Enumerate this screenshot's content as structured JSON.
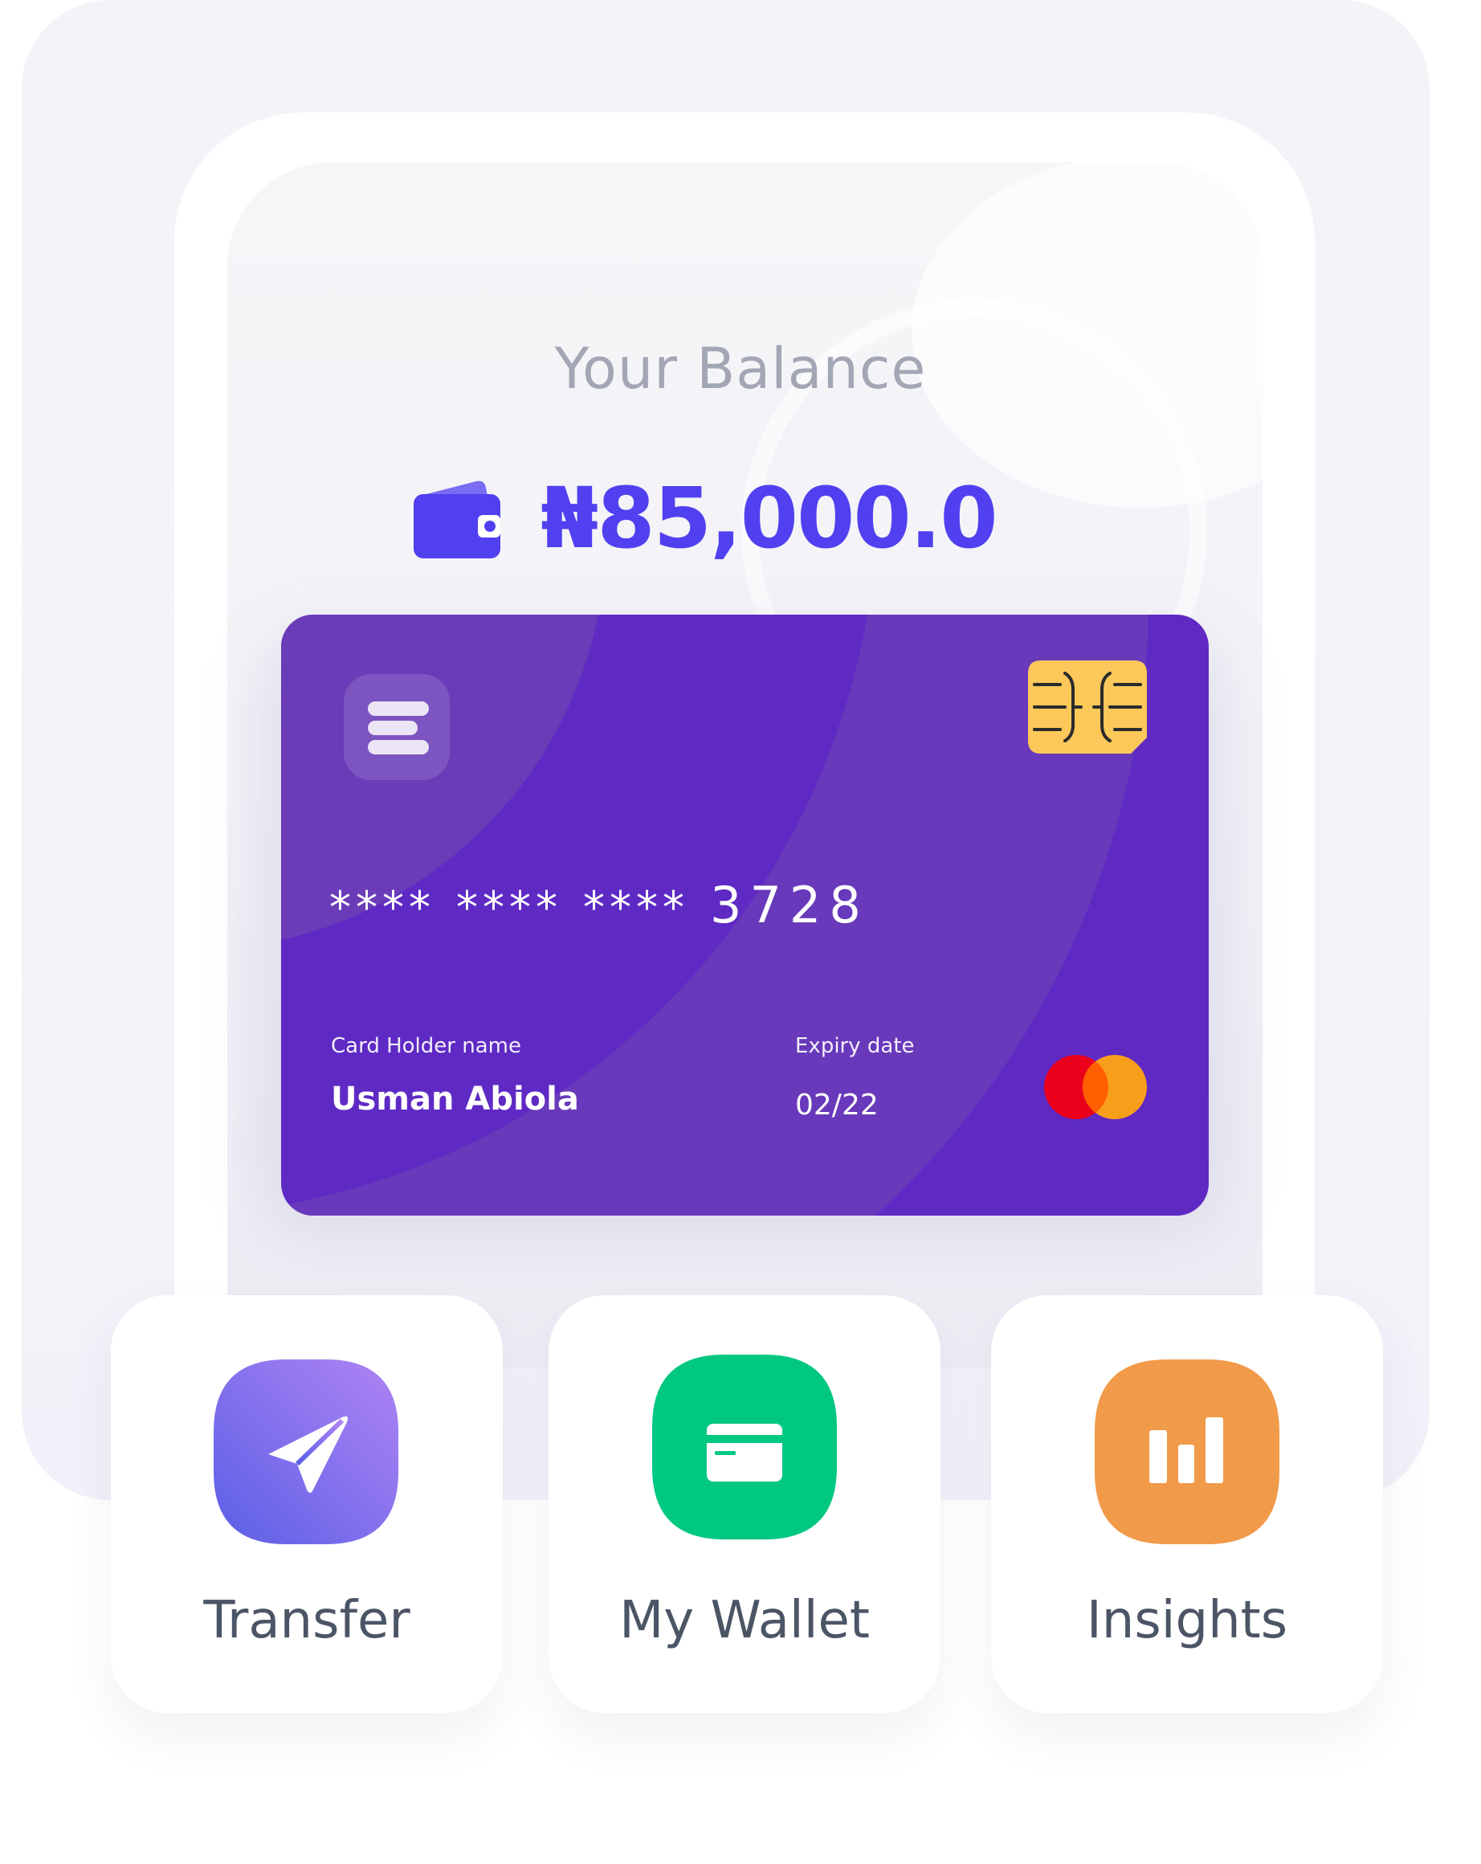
{
  "balance": {
    "label": "Your Balance",
    "amount": "₦85,000.0",
    "icon": "wallet-icon",
    "amount_color": "#5140F0"
  },
  "card": {
    "masked_groups": [
      "****",
      "****",
      "****"
    ],
    "last_four": "3728",
    "holder_label": "Card Holder name",
    "holder_name": "Usman Abiola",
    "expiry_label": "Expiry date",
    "expiry_value": "02/22",
    "network_icon": "mastercard-logo",
    "chip_icon": "sim-chip-icon",
    "logo_icon": "bank-logo-icon",
    "color": "#5F2AC4"
  },
  "actions": [
    {
      "label": "Transfer",
      "icon": "send-icon",
      "color": "#7B68EE"
    },
    {
      "label": "My Wallet",
      "icon": "card-icon",
      "color": "#00C880"
    },
    {
      "label": "Insights",
      "icon": "bar-chart-icon",
      "color": "#F19A4A"
    }
  ]
}
